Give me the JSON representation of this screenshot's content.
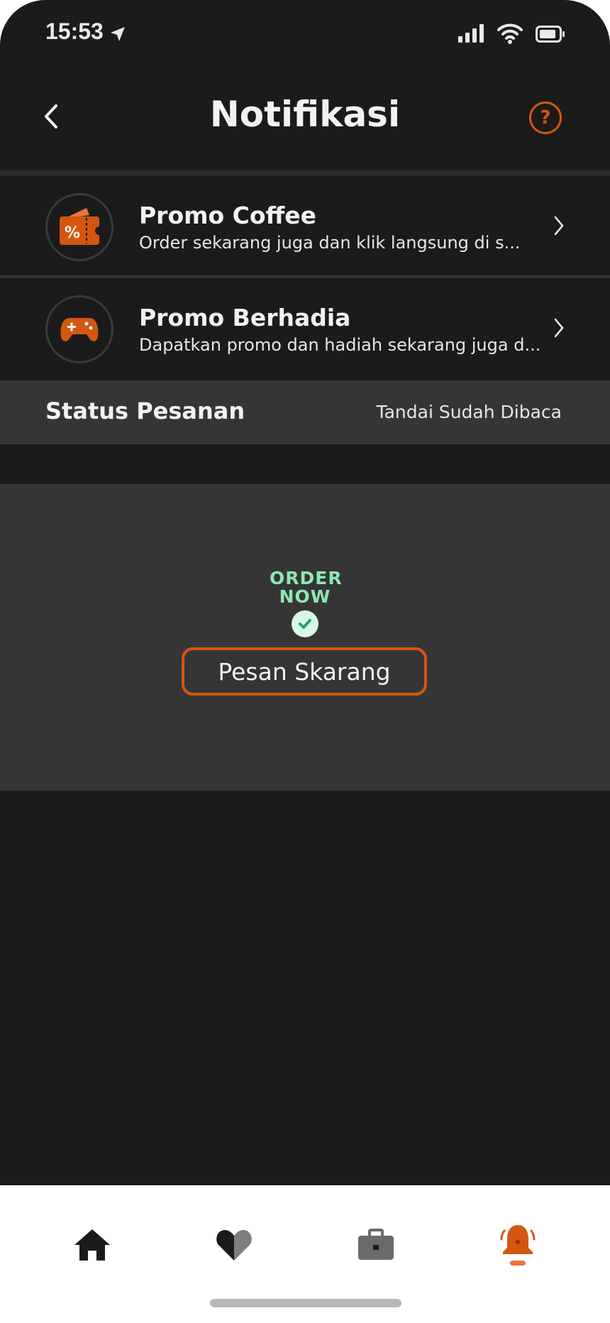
{
  "status_bar": {
    "time": "15:53"
  },
  "header": {
    "title": "Notifikasi"
  },
  "notifications": [
    {
      "title": "Promo Coffee",
      "subtitle": "Order sekarang juga dan klik langsung di s...",
      "icon": "ticket-discount-icon"
    },
    {
      "title": "Promo Berhadia",
      "subtitle": "Dapatkan promo dan hadiah sekarang juga d...",
      "icon": "gamepad-icon"
    }
  ],
  "section": {
    "title": "Status Pesanan",
    "action_label": "Tandai Sudah Dibaca"
  },
  "order_card": {
    "logo_line1": "ORDER",
    "logo_line2": "NOW",
    "button_label": "Pesan Skarang"
  },
  "bottom_nav": {
    "items": [
      {
        "icon": "home-icon",
        "active": false
      },
      {
        "icon": "heart-icon",
        "active": false
      },
      {
        "icon": "briefcase-icon",
        "active": false
      },
      {
        "icon": "bell-icon",
        "active": true
      }
    ]
  },
  "colors": {
    "accent": "#d4570f",
    "background": "#1b1b1b",
    "card": "#353535",
    "logo_green": "#8de8b3"
  }
}
